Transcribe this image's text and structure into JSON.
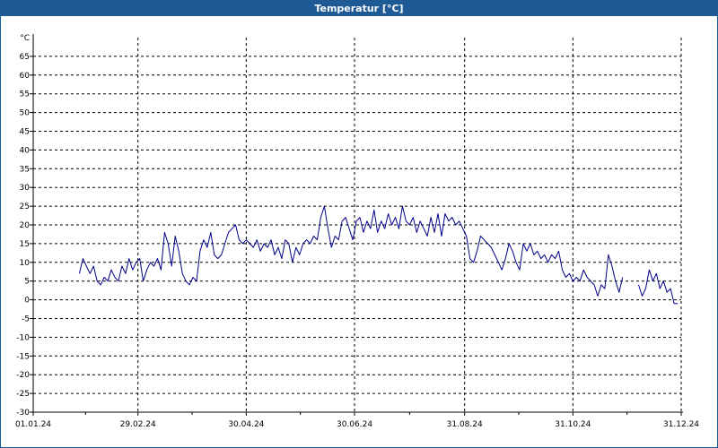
{
  "window": {
    "title": "Temperatur [°C]"
  },
  "chart_data": {
    "type": "line",
    "title": "Temperatur [°C]",
    "ylabel": "°C",
    "xlabel": "",
    "ylim": [
      -30,
      70
    ],
    "xlim": [
      "2024-01-01",
      "2024-12-31"
    ],
    "yticks": [
      65,
      60,
      55,
      50,
      45,
      40,
      35,
      30,
      25,
      20,
      15,
      10,
      5,
      0,
      -5,
      -10,
      -15,
      -20,
      -25,
      -30
    ],
    "xticks": [
      {
        "date": "2024-01-01",
        "label": "01.01.24"
      },
      {
        "date": "2024-02-29",
        "label": "29.02.24"
      },
      {
        "date": "2024-04-30",
        "label": "30.04.24"
      },
      {
        "date": "2024-06-30",
        "label": "30.06.24"
      },
      {
        "date": "2024-08-31",
        "label": "31.08.24"
      },
      {
        "date": "2024-10-31",
        "label": "31.10.24"
      },
      {
        "date": "2024-12-31",
        "label": "31.12.24"
      }
    ],
    "grid": true,
    "line_color": "#00008b",
    "grid_color": "#000000",
    "series": [
      {
        "points": [
          [
            "2024-01-27",
            7
          ],
          [
            "2024-01-29",
            11
          ],
          [
            "2024-01-31",
            9
          ],
          [
            "2024-02-02",
            7
          ],
          [
            "2024-02-04",
            9
          ],
          [
            "2024-02-06",
            5
          ],
          [
            "2024-02-08",
            4
          ],
          [
            "2024-02-10",
            6
          ],
          [
            "2024-02-12",
            5
          ],
          [
            "2024-02-14",
            8
          ],
          [
            "2024-02-16",
            6
          ],
          [
            "2024-02-18",
            5
          ],
          [
            "2024-02-20",
            9
          ],
          [
            "2024-02-22",
            7
          ],
          [
            "2024-02-24",
            11
          ],
          [
            "2024-02-26",
            8
          ],
          [
            "2024-02-28",
            10
          ],
          [
            "2024-03-01",
            11
          ],
          [
            "2024-03-03",
            5
          ],
          [
            "2024-03-05",
            8
          ],
          [
            "2024-03-07",
            10
          ],
          [
            "2024-03-09",
            9
          ],
          [
            "2024-03-11",
            11
          ],
          [
            "2024-03-13",
            8
          ],
          [
            "2024-03-15",
            18
          ],
          [
            "2024-03-17",
            15
          ],
          [
            "2024-03-19",
            9
          ],
          [
            "2024-03-21",
            17
          ],
          [
            "2024-03-23",
            13
          ],
          [
            "2024-03-25",
            7
          ],
          [
            "2024-03-27",
            5
          ],
          [
            "2024-03-29",
            4
          ],
          [
            "2024-03-31",
            6
          ],
          [
            "2024-04-02",
            5
          ],
          [
            "2024-04-04",
            13
          ],
          [
            "2024-04-06",
            16
          ],
          [
            "2024-04-08",
            14
          ],
          [
            "2024-04-10",
            18
          ],
          [
            "2024-04-12",
            12
          ],
          [
            "2024-04-14",
            11
          ],
          [
            "2024-04-16",
            12
          ],
          [
            "2024-04-18",
            15
          ],
          [
            "2024-04-20",
            18
          ],
          [
            "2024-04-22",
            19
          ],
          [
            "2024-04-24",
            20
          ],
          [
            "2024-04-26",
            16
          ],
          [
            "2024-04-28",
            15
          ],
          [
            "2024-04-30",
            16
          ],
          [
            "2024-05-02",
            15
          ],
          [
            "2024-05-04",
            14
          ],
          [
            "2024-05-06",
            16
          ],
          [
            "2024-05-08",
            13
          ],
          [
            "2024-05-10",
            15
          ],
          [
            "2024-05-12",
            14
          ],
          [
            "2024-05-14",
            16
          ],
          [
            "2024-05-16",
            12
          ],
          [
            "2024-05-18",
            14
          ],
          [
            "2024-05-20",
            11
          ],
          [
            "2024-05-22",
            16
          ],
          [
            "2024-05-24",
            15
          ],
          [
            "2024-05-26",
            10
          ],
          [
            "2024-05-28",
            14
          ],
          [
            "2024-05-30",
            12
          ],
          [
            "2024-06-01",
            15
          ],
          [
            "2024-06-03",
            16
          ],
          [
            "2024-06-05",
            15
          ],
          [
            "2024-06-07",
            17
          ],
          [
            "2024-06-09",
            16
          ],
          [
            "2024-06-11",
            22
          ],
          [
            "2024-06-13",
            25
          ],
          [
            "2024-06-15",
            19
          ],
          [
            "2024-06-17",
            14
          ],
          [
            "2024-06-19",
            17
          ],
          [
            "2024-06-21",
            16
          ],
          [
            "2024-06-23",
            21
          ],
          [
            "2024-06-25",
            22
          ],
          [
            "2024-06-27",
            19
          ],
          [
            "2024-06-29",
            16
          ],
          [
            "2024-07-01",
            21
          ],
          [
            "2024-07-03",
            22
          ],
          [
            "2024-07-05",
            18
          ],
          [
            "2024-07-07",
            21
          ],
          [
            "2024-07-09",
            19
          ],
          [
            "2024-07-11",
            24
          ],
          [
            "2024-07-13",
            18
          ],
          [
            "2024-07-15",
            21
          ],
          [
            "2024-07-17",
            19
          ],
          [
            "2024-07-19",
            23
          ],
          [
            "2024-07-21",
            20
          ],
          [
            "2024-07-23",
            22
          ],
          [
            "2024-07-25",
            19
          ],
          [
            "2024-07-27",
            25
          ],
          [
            "2024-07-29",
            21
          ],
          [
            "2024-07-31",
            20
          ],
          [
            "2024-08-02",
            22
          ],
          [
            "2024-08-04",
            18
          ],
          [
            "2024-08-06",
            21
          ],
          [
            "2024-08-08",
            19
          ],
          [
            "2024-08-10",
            17
          ],
          [
            "2024-08-12",
            22
          ],
          [
            "2024-08-14",
            18
          ],
          [
            "2024-08-16",
            23
          ],
          [
            "2024-08-18",
            17
          ],
          [
            "2024-08-20",
            23
          ],
          [
            "2024-08-22",
            21
          ],
          [
            "2024-08-24",
            22
          ],
          [
            "2024-08-26",
            20
          ],
          [
            "2024-08-28",
            21
          ],
          [
            "2024-08-30",
            19
          ],
          [
            "2024-09-01",
            17
          ],
          [
            "2024-09-03",
            11
          ],
          [
            "2024-09-05",
            10
          ],
          [
            "2024-09-07",
            13
          ],
          [
            "2024-09-09",
            17
          ],
          [
            "2024-09-11",
            16
          ],
          [
            "2024-09-13",
            15
          ],
          [
            "2024-09-15",
            14
          ],
          [
            "2024-09-17",
            12
          ],
          [
            "2024-09-19",
            10
          ],
          [
            "2024-09-21",
            8
          ],
          [
            "2024-09-23",
            11
          ],
          [
            "2024-09-25",
            15
          ],
          [
            "2024-09-27",
            13
          ],
          [
            "2024-09-29",
            10
          ],
          [
            "2024-10-01",
            8
          ],
          [
            "2024-10-03",
            15
          ],
          [
            "2024-10-05",
            13
          ],
          [
            "2024-10-07",
            15
          ],
          [
            "2024-10-09",
            12
          ],
          [
            "2024-10-11",
            13
          ],
          [
            "2024-10-13",
            11
          ],
          [
            "2024-10-15",
            12
          ],
          [
            "2024-10-17",
            10
          ],
          [
            "2024-10-19",
            12
          ],
          [
            "2024-10-21",
            11
          ],
          [
            "2024-10-23",
            13
          ],
          [
            "2024-10-25",
            8
          ],
          [
            "2024-10-27",
            6
          ],
          [
            "2024-10-29",
            7
          ],
          [
            "2024-10-31",
            5
          ],
          [
            "2024-11-02",
            6
          ],
          [
            "2024-11-04",
            5
          ],
          [
            "2024-11-06",
            8
          ],
          [
            "2024-11-08",
            6
          ],
          [
            "2024-11-10",
            5
          ],
          [
            "2024-11-12",
            4
          ],
          [
            "2024-11-14",
            1
          ],
          [
            "2024-11-16",
            4
          ],
          [
            "2024-11-18",
            3
          ],
          [
            "2024-11-20",
            12
          ],
          [
            "2024-11-22",
            9
          ],
          [
            "2024-11-24",
            5
          ],
          [
            "2024-11-26",
            2
          ],
          [
            "2024-11-28",
            6
          ],
          [
            null,
            null
          ],
          [
            "2024-12-07",
            4
          ],
          [
            "2024-12-09",
            1
          ],
          [
            "2024-12-11",
            3
          ],
          [
            "2024-12-13",
            8
          ],
          [
            "2024-12-15",
            5
          ],
          [
            "2024-12-17",
            7
          ],
          [
            "2024-12-19",
            3
          ],
          [
            "2024-12-21",
            5
          ],
          [
            "2024-12-23",
            2
          ],
          [
            "2024-12-25",
            3
          ],
          [
            "2024-12-27",
            -1
          ],
          [
            "2024-12-29",
            -1
          ]
        ]
      }
    ]
  }
}
